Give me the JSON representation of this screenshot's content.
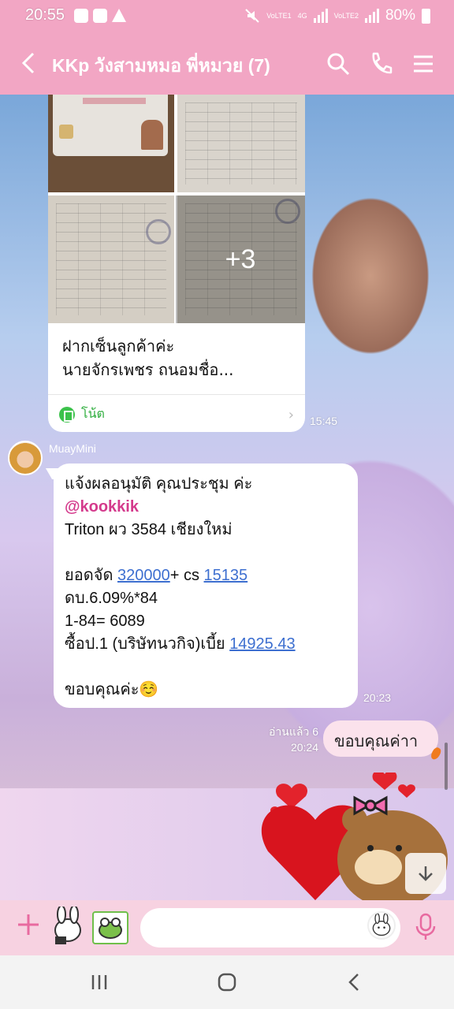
{
  "status_bar": {
    "time": "20:55",
    "network_1": "VoLTE1",
    "network_2": "4G",
    "network_3": "VoLTE2",
    "battery": "80%"
  },
  "header": {
    "title": "KKp วังสามหมอ พี่หมวย (7)",
    "icons": [
      "back-icon",
      "search-icon",
      "phone-icon",
      "menu-icon"
    ]
  },
  "album_message": {
    "more_count": "+3",
    "caption_line1": "ฝากเซ็นลูกค้าค่ะ",
    "caption_line2": "นายจักรเพชร ถนอมชื่อ...",
    "note_label": "โน้ต",
    "time": "15:45"
  },
  "incoming_message": {
    "sender": "MuayMini",
    "line1": "แจ้งผลอนุมัติ คุณประชุม ค่ะ",
    "mention": "@kookkik",
    "line3": "Triton ผว 3584 เชียงใหม่",
    "line5_prefix": "ยอดจัด ",
    "line5_link1": "320000",
    "line5_mid": "+ cs ",
    "line5_link2": "15135",
    "line6": "ดบ.6.09%*84",
    "line7": "1-84= 6089",
    "line8_prefix": "ซื้อป.1 (บริษัทนวกิจ)เบี้ย ",
    "line8_link": "14925.43",
    "line10": "ขอบคุณค่ะ☺️",
    "time": "20:23"
  },
  "outgoing_message": {
    "read_status": "อ่านแล้ว 6",
    "time": "20:24",
    "text": "ขอบคุณค่าา"
  },
  "colors": {
    "header_bg": "#f2a6c4",
    "mention": "#d43a8c",
    "link": "#3d6fd0",
    "note_green": "#2fae3e",
    "outgoing_bubble": "#fbe2ec"
  }
}
